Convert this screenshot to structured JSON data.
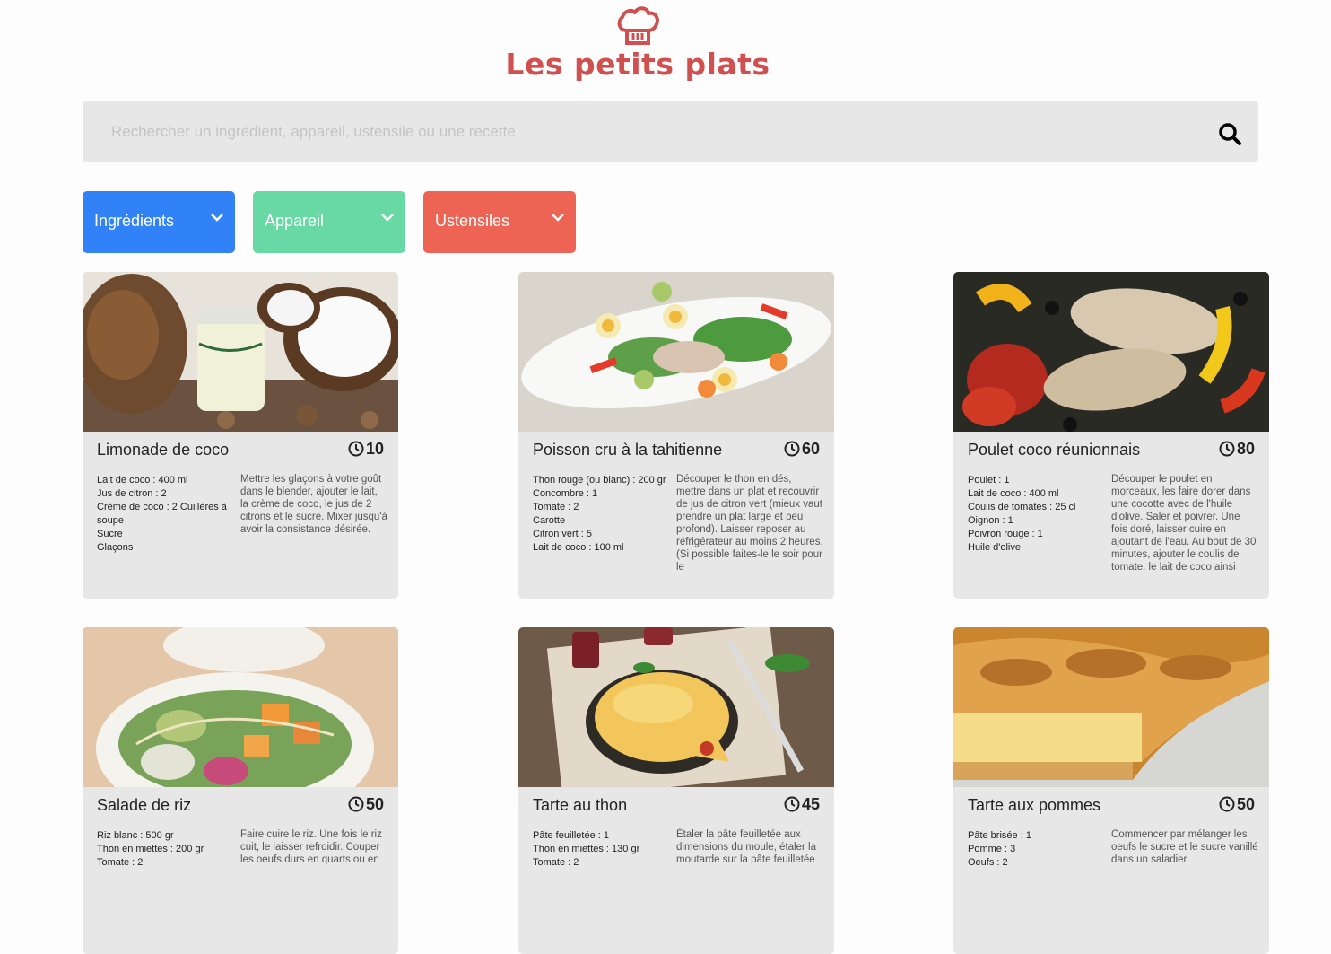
{
  "header": {
    "title": "Les petits plats"
  },
  "search": {
    "placeholder": "Rechercher un ingrédient, appareil, ustensile ou une recette"
  },
  "filters": [
    {
      "label": "Ingrédients",
      "color": "#3282f7"
    },
    {
      "label": "Appareil",
      "color": "#68d9a4"
    },
    {
      "label": "Ustensiles",
      "color": "#ed6454"
    }
  ],
  "recipes": [
    {
      "name": "Limonade de coco",
      "time": "10",
      "ingredients": [
        "Lait de coco : 400 ml",
        "Jus de citron : 2",
        "Crème de coco : 2 Cuillères à soupe",
        "Sucre",
        "Glaçons"
      ],
      "description": "Mettre les glaçons à votre goût dans le blender, ajouter le lait, la crème de coco, le jus de 2 citrons et le sucre. Mixer jusqu'à avoir la consistance désirée."
    },
    {
      "name": "Poisson cru à la tahitienne",
      "time": "60",
      "ingredients": [
        "Thon rouge (ou blanc) : 200 gr",
        "Concombre : 1",
        "Tomate : 2",
        "Carotte",
        "Citron vert : 5",
        "Lait de coco : 100 ml"
      ],
      "description": "Découper le thon en dés, mettre dans un plat et recouvrir de jus de citron vert (mieux vaut prendre un plat large et peu profond). Laisser reposer au réfrigérateur au moins 2 heures. (Si possible faites-le le soir pour le"
    },
    {
      "name": "Poulet coco réunionnais",
      "time": "80",
      "ingredients": [
        "Poulet : 1",
        "Lait de coco : 400 ml",
        "Coulis de tomates : 25 cl",
        "Oignon : 1",
        "Poivron rouge : 1",
        "Huile d'olive"
      ],
      "description": "Découper le poulet en morceaux, les faire dorer dans une cocotte avec de l'huile d'olive. Saler et poivrer. Une fois doré, laisser cuire en ajoutant de l'eau. Au bout de 30 minutes, ajouter le coulis de tomate, le lait de coco ainsi"
    },
    {
      "name": "Salade de riz",
      "time": "50",
      "ingredients": [
        "Riz blanc : 500 gr",
        "Thon en miettes : 200 gr",
        "Tomate : 2"
      ],
      "description": "Faire cuire le riz. Une fois le riz cuit, le laisser refroidir. Couper les oeufs durs en quarts ou en"
    },
    {
      "name": "Tarte au thon",
      "time": "45",
      "ingredients": [
        "Pâte feuilletée : 1",
        "Thon en miettes : 130 gr",
        "Tomate : 2"
      ],
      "description": "Étaler la pâte feuilletée aux dimensions du moule, étaler la moutarde sur la pâte feuilletée"
    },
    {
      "name": "Tarte aux pommes",
      "time": "50",
      "ingredients": [
        "Pâte brisée : 1",
        "Pomme : 3",
        "Oeufs : 2"
      ],
      "description": "Commencer par mélanger les oeufs le sucre et le sucre vanillé dans un saladier"
    }
  ]
}
